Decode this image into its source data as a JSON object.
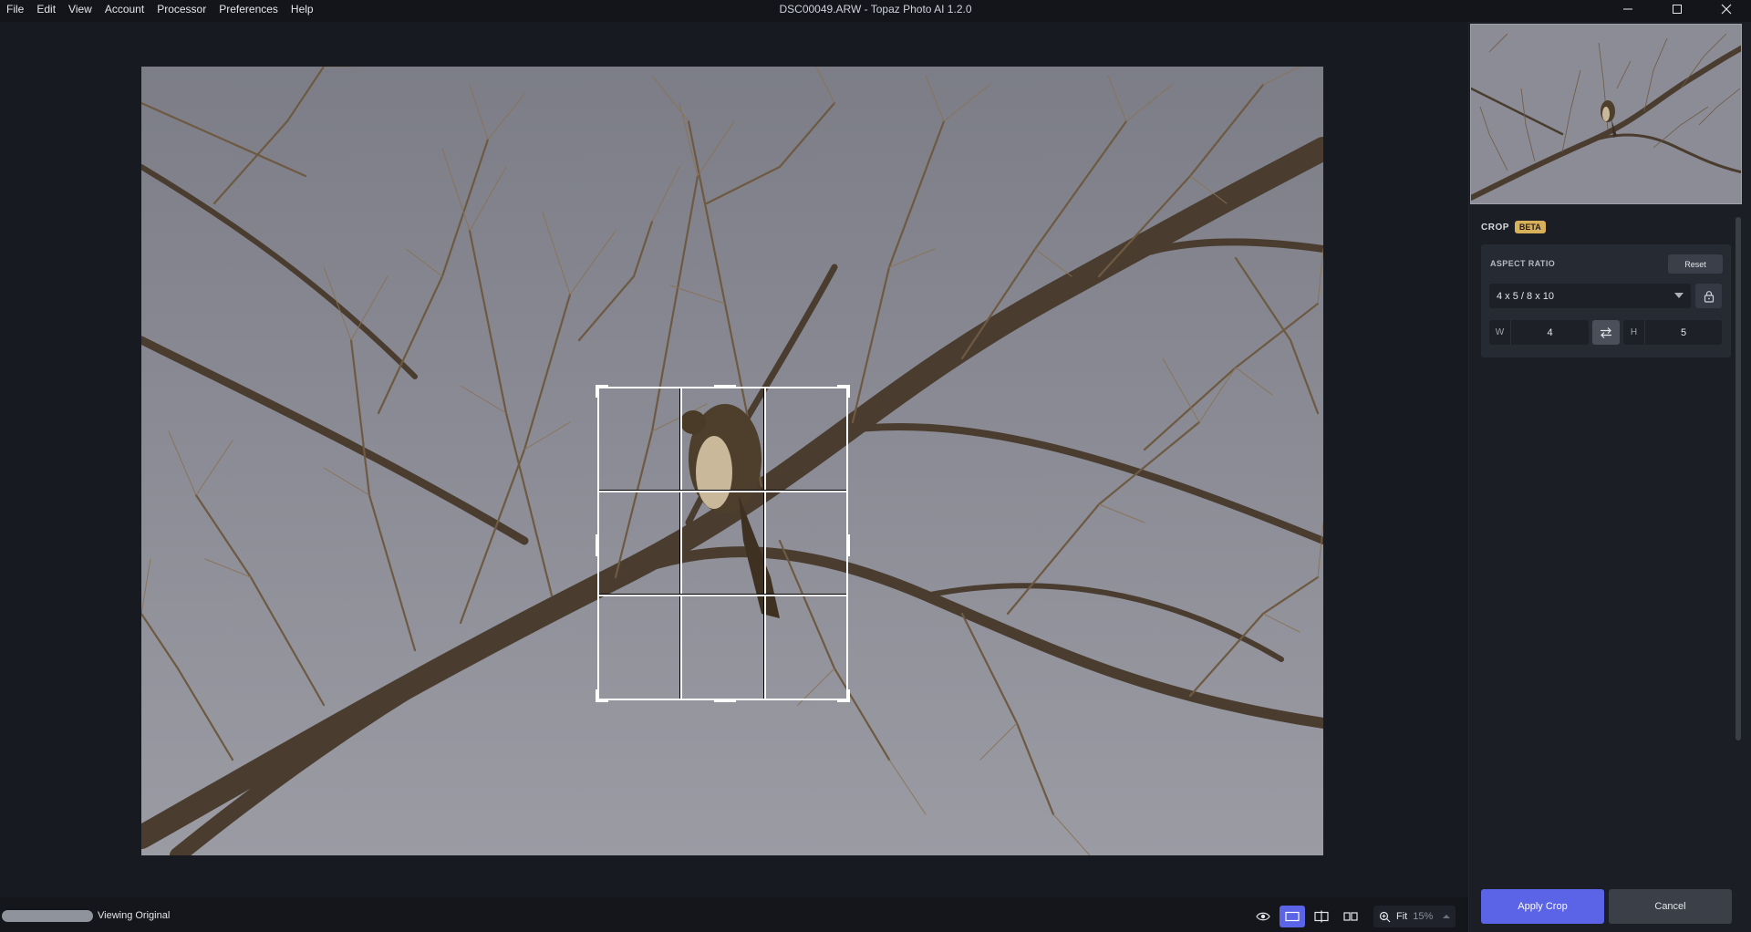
{
  "window": {
    "title": "DSC00049.ARW - Topaz Photo AI 1.2.0"
  },
  "menu": {
    "items": [
      "File",
      "Edit",
      "View",
      "Account",
      "Processor",
      "Preferences",
      "Help"
    ]
  },
  "crop_panel": {
    "title": "CROP",
    "badge": "BETA",
    "aspect_ratio_label": "ASPECT RATIO",
    "reset_label": "Reset",
    "selected_ratio": "4 x 5 / 8 x 10",
    "width_tag": "W",
    "width_value": "4",
    "height_tag": "H",
    "height_value": "5",
    "apply_label": "Apply Crop",
    "cancel_label": "Cancel"
  },
  "status": {
    "viewing_label": "Viewing Original",
    "zoom_mode": "Fit",
    "zoom_value": "15%"
  },
  "colors": {
    "accent": "#5b63e6",
    "beta_badge": "#d8b05a",
    "background": "#171a21"
  },
  "icons": [
    "minimize-icon",
    "maximize-icon",
    "close-icon",
    "chevron-down-icon",
    "lock-icon",
    "swap-icon",
    "eye-icon",
    "single-view-icon",
    "split-view-icon",
    "side-by-side-icon",
    "zoom-icon",
    "chevron-up-icon"
  ]
}
